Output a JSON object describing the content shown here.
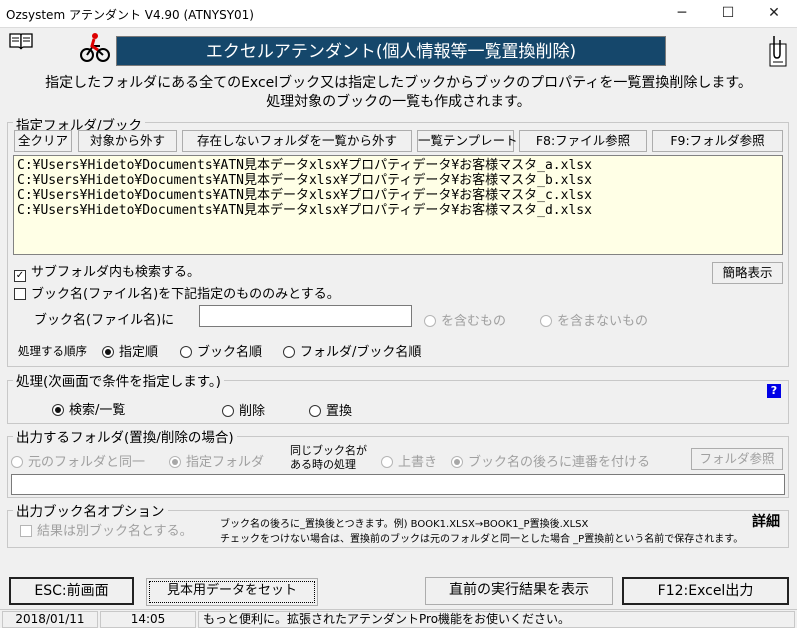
{
  "window": {
    "title": "Ozsystem アテンダント V4.90 (ATNYSY01)",
    "minimize": "─",
    "maximize": "☐",
    "close": "✕"
  },
  "header": {
    "banner": "エクセルアテンダント(個人情報等一覧置換削除)",
    "desc_line1": "指定したフォルダにある全てのExcelブック又は指定したブックからブックのプロパティを一覧置換削除します。",
    "desc_line2": "処理対象のブックの一覧も作成されます。"
  },
  "folder_group": {
    "legend": "指定フォルダ/ブック",
    "buttons": {
      "clear_all": "全クリア",
      "remove": "対象から外す",
      "remove_missing": "存在しないフォルダを一覧から外す",
      "template": "一覧テンプレート",
      "f8": "F8:ファイル参照",
      "f9": "F9:フォルダ参照"
    },
    "files": [
      "C:¥Users¥Hideto¥Documents¥ATN見本データxlsx¥プロパティデータ¥お客様マスタ_a.xlsx",
      "C:¥Users¥Hideto¥Documents¥ATN見本データxlsx¥プロパティデータ¥お客様マスタ_b.xlsx",
      "C:¥Users¥Hideto¥Documents¥ATN見本データxlsx¥プロパティデータ¥お客様マスタ_c.xlsx",
      "C:¥Users¥Hideto¥Documents¥ATN見本データxlsx¥プロパティデータ¥お客様マスタ_d.xlsx"
    ],
    "subfolder_label": "サブフォルダ内も検索する。",
    "simple_view": "簡略表示",
    "bookname_only_label": "ブック名(ファイル名)を下記指定のもののみとする。",
    "bookname_field_label": "ブック名(ファイル名)に",
    "bookname_value": "",
    "contains": "を含むもの",
    "not_contains": "を含まないもの",
    "order_label": "処理する順序",
    "order_options": [
      "指定順",
      "ブック名順",
      "フォルダ/ブック名順"
    ]
  },
  "process_group": {
    "legend": "処理(次画面で条件を指定します。)",
    "options": [
      "検索/一覧",
      "削除",
      "置換"
    ],
    "help": "?"
  },
  "output_group": {
    "legend": "出力するフォルダ(置換/削除の場合)",
    "same_folder": "元のフォルダと同一",
    "specified_folder": "指定フォルダ",
    "same_name_line1": "同じブック名が",
    "same_name_line2": "ある時の処理",
    "overwrite": "上書き",
    "suffix": "ブック名の後ろに連番を付ける",
    "folder_ref": "フォルダ参照",
    "path_value": ""
  },
  "bookname_group": {
    "legend": "出力ブック名オプション",
    "separate_label": "結果は別ブック名とする。",
    "note1": "ブック名の後ろに_置換後とつきます。例) BOOK1.XLSX→BOOK1_P置換後.XLSX",
    "note2": "チェックをつけない場合は、置換前のブックは元のフォルダと同一とした場合 _P置換前という名前で保存されます。",
    "detail": "詳細"
  },
  "footer": {
    "esc": "ESC:前画面",
    "sample": "見本用データをセット",
    "last_result": "直前の実行結果を表示",
    "f12": "F12:Excel出力"
  },
  "status": {
    "date": "2018/01/11",
    "time": "14:05",
    "message": "もっと便利に。拡張されたアテンダントPro機能をお使いください。"
  }
}
